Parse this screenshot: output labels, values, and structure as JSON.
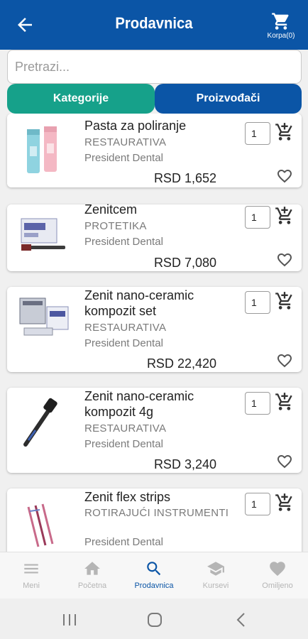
{
  "header": {
    "title": "Prodavnica",
    "cart_label": "Korpa(0)"
  },
  "search": {
    "placeholder": "Pretrazi..."
  },
  "tabs": [
    {
      "label": "Kategorije"
    },
    {
      "label": "Proizvođači"
    }
  ],
  "products": [
    {
      "name": "Pasta za poliranje",
      "category": "RESTAURATIVA",
      "brand": "President Dental",
      "price": "RSD 1,652",
      "qty": "1"
    },
    {
      "name": "Zenitcem",
      "category": "PROTETIKA",
      "brand": "President Dental",
      "price": "RSD 7,080",
      "qty": "1"
    },
    {
      "name": "Zenit nano-ceramic kompozit set",
      "category": "RESTAURATIVA",
      "brand": "President Dental",
      "price": "RSD 22,420",
      "qty": "1"
    },
    {
      "name": "Zenit nano-ceramic kompozit 4g",
      "category": "RESTAURATIVA",
      "brand": "President Dental",
      "price": "RSD 3,240",
      "qty": "1"
    },
    {
      "name": "Zenit flex strips",
      "category": "ROTIRAJUĆI INSTRUMENTI",
      "brand": "President Dental",
      "qty": "1"
    }
  ],
  "nav": [
    {
      "label": "Meni",
      "icon": "menu-icon"
    },
    {
      "label": "Početna",
      "icon": "home-icon"
    },
    {
      "label": "Prodavnica",
      "icon": "search-icon",
      "active": true
    },
    {
      "label": "Kursevi",
      "icon": "graduation-cap-icon"
    },
    {
      "label": "Omiljeno",
      "icon": "heart-icon"
    }
  ],
  "colors": {
    "primary": "#0b55a6",
    "accent": "#16a18a",
    "inactive": "#b5b5b5"
  }
}
